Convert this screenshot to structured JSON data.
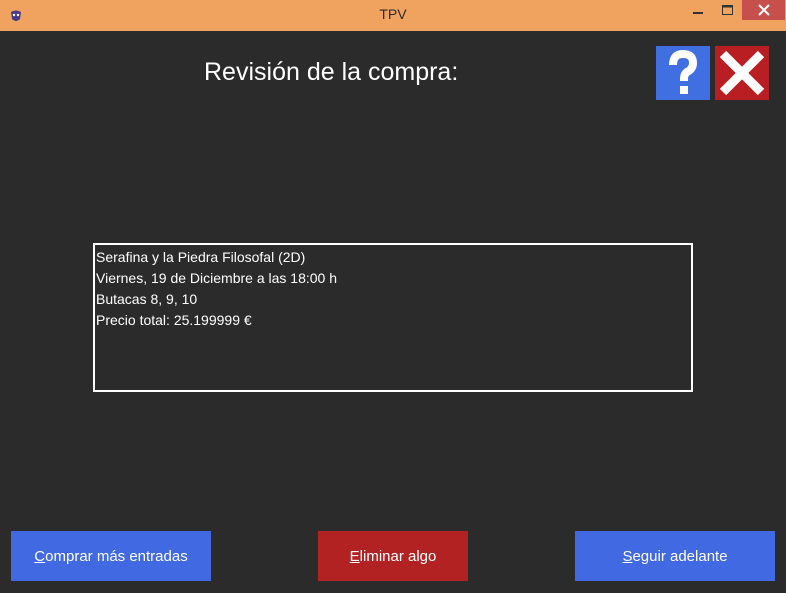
{
  "window": {
    "title": "TPV",
    "icon": "mask-icon",
    "controls": [
      "minimize-icon",
      "maximize-icon",
      "close-icon"
    ],
    "titlebar_color": "#f0a35e"
  },
  "header": {
    "title": "Revisión de la compra:",
    "help_icon": "question-mark-icon",
    "exit_icon": "red-x-icon"
  },
  "summary": {
    "lines": [
      "Serafina y la Piedra Filosofal (2D)",
      "Viernes, 19 de Diciembre a las 18:00 h",
      "Butacas 8, 9, 10",
      "Precio total: 25.199999 €"
    ]
  },
  "buttons": {
    "buy_more": {
      "mnemonic": "C",
      "rest": "omprar más entradas",
      "color": "#4169e1"
    },
    "remove": {
      "mnemonic": "E",
      "rest": "liminar algo",
      "color": "#b22222"
    },
    "continue": {
      "mnemonic": "S",
      "rest": "eguir adelante",
      "color": "#4169e1"
    }
  }
}
